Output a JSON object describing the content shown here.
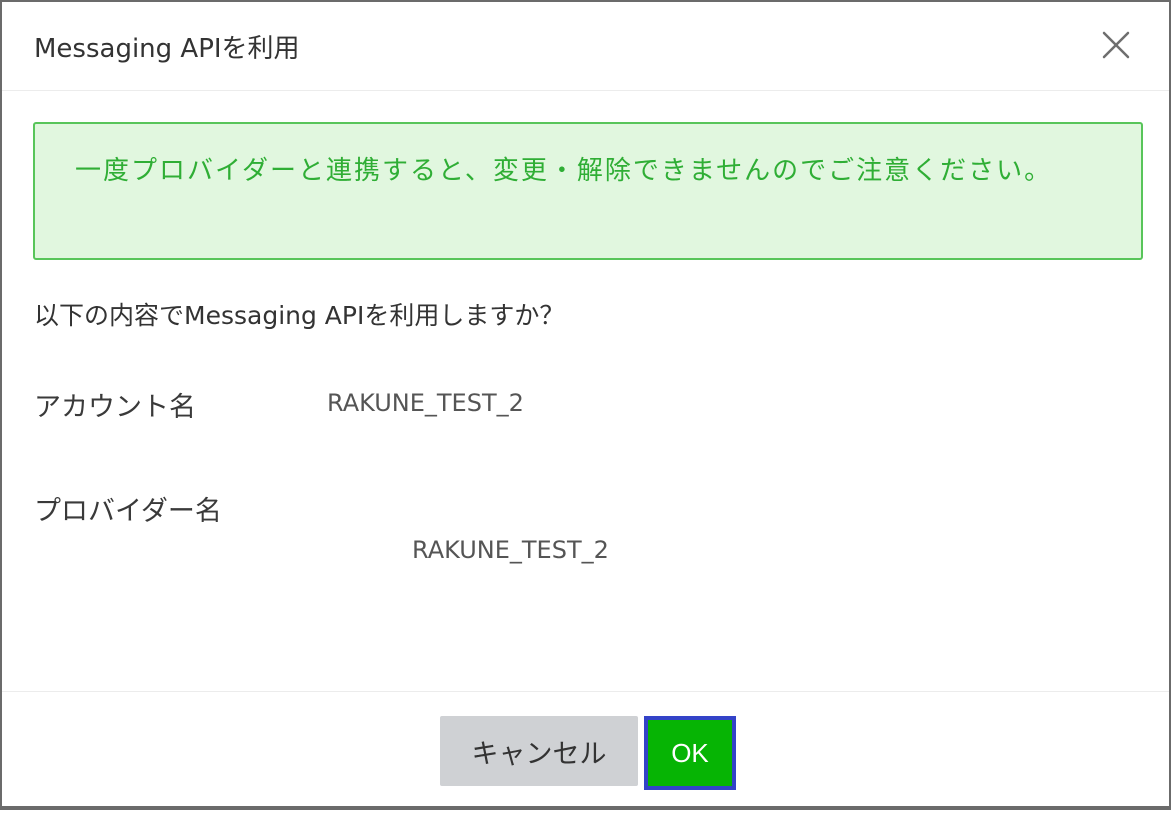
{
  "dialog": {
    "title": "Messaging APIを利用",
    "close_icon": "close-icon"
  },
  "alert": {
    "message": "一度プロバイダーと連携すると、変更・解除できませんのでご注意ください。"
  },
  "body": {
    "question": "以下の内容でMessaging APIを利用しますか？",
    "account_label": "アカウント名",
    "account_value": "RAKUNE_TEST_2",
    "provider_label": "プロバイダー名",
    "provider_value": "RAKUNE_TEST_2"
  },
  "footer": {
    "cancel_label": "キャンセル",
    "ok_label": "OK"
  },
  "colors": {
    "alert_background": "#e1f7df",
    "alert_border": "#58c55a",
    "alert_text": "#2fae35",
    "ok_button": "#06b404",
    "ok_focus_ring": "#3343c8",
    "cancel_button": "#cfd1d4"
  }
}
